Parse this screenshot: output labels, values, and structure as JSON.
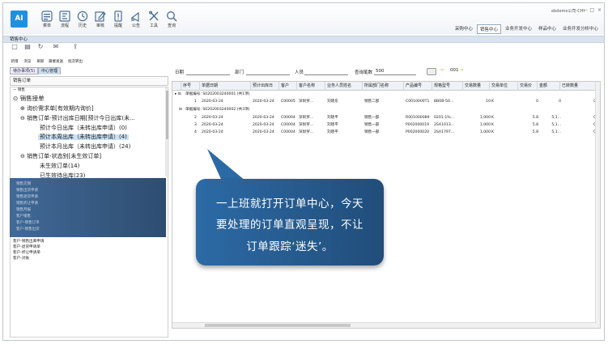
{
  "app": {
    "logo_text": "AI",
    "user_info": "ebdemo公司-CHI",
    "window_title": "销售中心",
    "toolbar": [
      {
        "label": "菜单",
        "icon": "menu-icon"
      },
      {
        "label": "流程",
        "icon": "flow-icon"
      },
      {
        "label": "历史",
        "icon": "clock-icon"
      },
      {
        "label": "审核",
        "icon": "edit-icon"
      },
      {
        "label": "提醒",
        "icon": "alert-icon"
      },
      {
        "label": "公告",
        "icon": "notice-icon"
      },
      {
        "label": "工具",
        "icon": "tools-icon"
      },
      {
        "label": "查询",
        "icon": "search-icon"
      }
    ],
    "modules": [
      "采购中心",
      "销售中心",
      "业务开发中心",
      "样品中心",
      "业务开发分析中心"
    ],
    "active_module": "销售中心",
    "accent": "#1f8fe0"
  },
  "actions": [
    "新增",
    "浏览",
    "刷新",
    "跟催发送",
    "批次转出"
  ],
  "left": {
    "tabs": [
      "待办事项(5)",
      "中心管理"
    ],
    "header": "销售订单",
    "tree": [
      "— 销售",
      "⊙ 销售接单",
      "⊕ 询价需求单[有效期内询价]",
      "⊖ 销售订单-预计出库日期[预计今日出库(未...",
      "预计今日出库（未转出库申请）(0)",
      "预计本周出库（未转出库申请）(4)",
      "预计本月出库（未转出库申请）(24)",
      "⊖ 销售订单-状态别[未生效订单]",
      "未生效订单(14)",
      "已生效待出库(23)"
    ],
    "dim_items": [
      "销售交期",
      "销售出货申请",
      "销售退货申请",
      "销售折让申请",
      "销售月报",
      "客户销售",
      "客户-销售订单",
      "客户-销售出货"
    ],
    "lower_items": [
      "客户-销售出库申请",
      "客户-退货申请单",
      "客户-折让申请单",
      "客户-对账"
    ]
  },
  "filters": {
    "date": "日期",
    "dept": "部门",
    "person": "人员",
    "count_label": "查询笔数",
    "count": "500",
    "page": "001"
  },
  "grid": {
    "columns": [
      "序号",
      "单据日期",
      "预计出库日",
      "客户",
      "客户名称",
      "业务人员姓名",
      "所属部门名称",
      "产品编号",
      "规格型号",
      "交易数量",
      "交易单位",
      "交易价",
      "金额",
      "已转数量"
    ],
    "group1": "单据编号: S0202003240001 (共1项)",
    "group2": "单据编号: S0202003240002 (共3项)",
    "rows": [
      [
        "1",
        "2020-03-24",
        "2020-03-24",
        "C00005",
        "深圳罗...",
        "刘晓东",
        "销售二部",
        "C0010000T1",
        "BB0B-50...",
        "10",
        "K",
        "0",
        "0",
        "0"
      ],
      [
        "2",
        "2020-03-24",
        "2020-03-24",
        "C00004",
        "深圳罗...",
        "刘晓平",
        "销售一部",
        "R001000089",
        "0201-1%...",
        "1,000",
        "K",
        "5.8",
        "5,1...",
        "0"
      ],
      [
        "3",
        "2020-03-24",
        "2020-03-24",
        "C00004",
        "深圳罗...",
        "刘晓平",
        "销售一部",
        "P002000019",
        "2SA1013...",
        "1,000",
        "K",
        "5.8",
        "5,1...",
        "0"
      ],
      [
        "4",
        "2020-03-24",
        "2020-03-24",
        "C00004",
        "深圳罗...",
        "刘晓平",
        "销售一部",
        "P002000020",
        "2SA1797...",
        "1,000",
        "K",
        "5.8",
        "5,1...",
        "0"
      ]
    ]
  },
  "callout": {
    "line1": "一上班就打开订单中心，今天",
    "line2": "要处理的订单直观呈现，不让",
    "line3": "订单跟踪‘迷失’。"
  }
}
